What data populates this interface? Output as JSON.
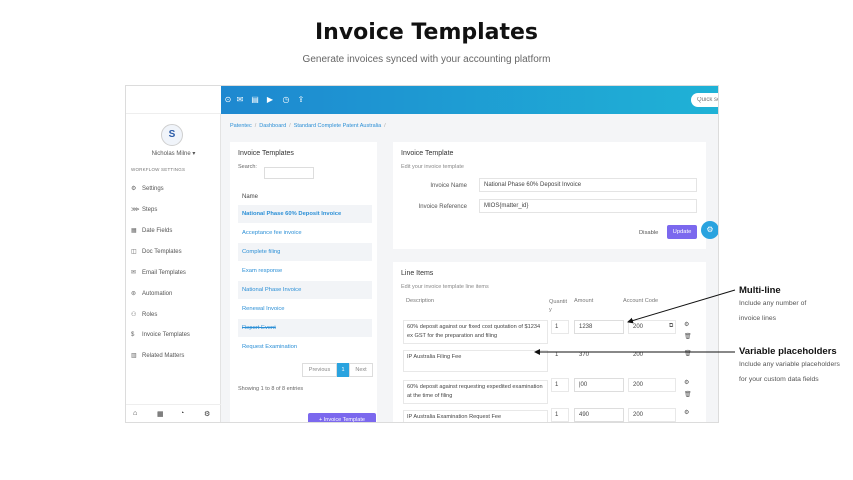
{
  "hero": {
    "title": "Invoice Templates",
    "subtitle": "Generate invoices synced with your accounting platform"
  },
  "topbar": {
    "icons": [
      "circle-arrow-icon",
      "mail-icon",
      "card-icon",
      "play-icon",
      "clock-icon",
      "upload-icon"
    ],
    "search_placeholder": "Quick search...",
    "right_icons": [
      "brand-icon",
      "grid-icon"
    ]
  },
  "sidebar": {
    "user_name": "Nicholas Milne",
    "section_label": "WORKFLOW SETTINGS",
    "items": [
      {
        "label": "Settings",
        "icon": "gear-icon"
      },
      {
        "label": "Steps",
        "icon": "steps-icon"
      },
      {
        "label": "Date Fields",
        "icon": "calendar-icon"
      },
      {
        "label": "Doc Templates",
        "icon": "book-icon"
      },
      {
        "label": "Email Templates",
        "icon": "envelope-icon"
      },
      {
        "label": "Automation",
        "icon": "automation-icon"
      },
      {
        "label": "Roles",
        "icon": "users-icon"
      },
      {
        "label": "Invoice Templates",
        "icon": "dollar-icon"
      },
      {
        "label": "Related Matters",
        "icon": "map-icon"
      }
    ],
    "footer_icons": [
      "bank-icon",
      "grid-icon",
      "palette-icon",
      "settings-icon"
    ]
  },
  "breadcrumb": [
    "Patentec",
    "Dashboard",
    "Standard Complete Patent Australia"
  ],
  "left_panel": {
    "title": "Invoice Templates",
    "search_label": "Search:",
    "column_name": "Name",
    "templates": [
      "National Phase 60% Deposit Invoice",
      "Acceptance fee invoice",
      "Complete filing",
      "Exam response",
      "National Phase Invoice",
      "Renewal Invoice",
      "Report Event",
      "Request Examination"
    ],
    "pager": {
      "previous": "Previous",
      "current": "1",
      "next": "Next"
    },
    "showing": "Showing 1 to 8 of 8 entries",
    "add_button": "+ Invoice Template"
  },
  "template_panel": {
    "title": "Invoice Template",
    "subtitle": "Edit your invoice template",
    "name_label": "Invoice Name",
    "name_value": "National Phase 60% Deposit Invoice",
    "ref_label": "Invoice Reference",
    "ref_value": "MIOS{matter_id}",
    "disable_label": "Disable",
    "update_label": "Update"
  },
  "line_items": {
    "title": "Line Items",
    "subtitle": "Edit your invoice template line items",
    "headers": {
      "description": "Description",
      "quantity": "Quantit\ny",
      "amount": "Amount",
      "account": "Account Code"
    },
    "rows": [
      {
        "description": "60% deposit against our fixed cost quotation of $1234 ex GST for the preparation and filing",
        "quantity": "1",
        "amount": "1238",
        "account": "200"
      },
      {
        "description": "IP Australia Filing Fee",
        "quantity": "1",
        "amount": "370",
        "account": "200"
      },
      {
        "description": "60% deposit against requesting expedited examination at the time of filing",
        "quantity": "1",
        "amount": "|00",
        "account": "200"
      },
      {
        "description": "IP Australia Examination Request Fee",
        "quantity": "1",
        "amount": "490",
        "account": "200"
      }
    ]
  },
  "callouts": {
    "multiline_title": "Multi-line",
    "multiline_text_1": "Include any number of",
    "multiline_text_2": "invoice lines",
    "placeholders_title": "Variable placeholders",
    "placeholders_text_1": "Include any variable placeholders",
    "placeholders_text_2": "for your custom data fields"
  }
}
